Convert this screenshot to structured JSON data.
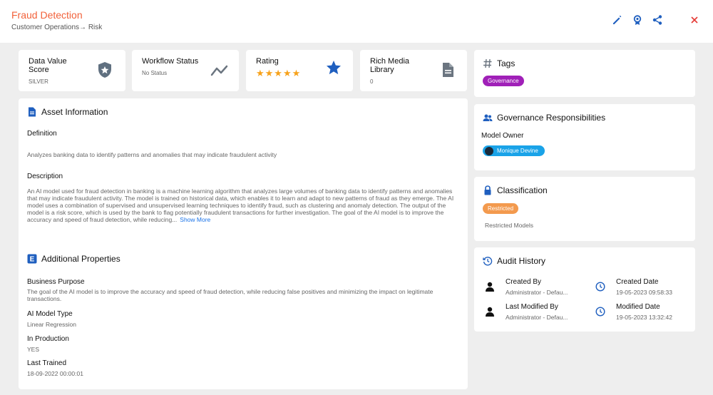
{
  "header": {
    "title": "Fraud Detection",
    "breadcrumb": "Customer Operations→ Risk"
  },
  "stats": {
    "data_value": {
      "label": "Data Value Score",
      "value": "SILVER"
    },
    "workflow": {
      "label": "Workflow Status",
      "value": "No Status"
    },
    "rating": {
      "label": "Rating",
      "stars": "★★★★★",
      "score": 5,
      "max": 5
    },
    "rich_media": {
      "label": "Rich Media Library",
      "value": "0"
    }
  },
  "asset_info": {
    "title": "Asset Information",
    "definition_label": "Definition",
    "definition": "Analyzes banking data to identify patterns and anomalies that may indicate fraudulent activity",
    "description_label": "Description",
    "description": "An AI model used for fraud detection in banking is a machine learning algorithm that analyzes large volumes of banking data to identify patterns and anomalies that may indicate fraudulent activity. The model is trained on historical data, which enables it to learn and adapt to new patterns of fraud as they emerge. The AI model uses a combination of supervised and unsupervised learning techniques to identify fraud, such as clustering and anomaly detection. The output of the model is a risk score, which is used by the bank to flag potentially fraudulent transactions for further investigation. The goal of the AI model is to improve the accuracy and speed of fraud detection, while reducing...",
    "show_more": "Show More"
  },
  "additional": {
    "title": "Additional Properties",
    "badge": "E",
    "business_purpose_label": "Business Purpose",
    "business_purpose": "The goal of the AI model is to improve the accuracy and speed of fraud detection, while reducing false positives and minimizing the impact on legitimate transactions.",
    "model_type_label": "AI Model Type",
    "model_type": "Linear Regression",
    "in_production_label": "In Production",
    "in_production": "YES",
    "last_trained_label": "Last Trained",
    "last_trained": "18-09-2022 00:00:01"
  },
  "tags": {
    "title": "Tags",
    "items": [
      "Governance"
    ]
  },
  "governance": {
    "title": "Governance Responsibilities",
    "owner_label": "Model Owner",
    "owner": "Monique Devine"
  },
  "classification": {
    "title": "Classification",
    "badge": "Restricted",
    "text": "Restricted Models"
  },
  "audit": {
    "title": "Audit History",
    "created_by_label": "Created By",
    "created_by": "Administrator - Defau...",
    "created_date_label": "Created Date",
    "created_date": "19-05-2023 09:58:33",
    "modified_by_label": "Last Modified By",
    "modified_by": "Administrator - Defau...",
    "modified_date_label": "Modified Date",
    "modified_date": "19-05-2023 13:32:42"
  },
  "colors": {
    "title": "#f2613a",
    "accent": "#1f5fbf",
    "tag": "#a020b8",
    "owner_pill": "#1aa3e8",
    "restricted": "#f39a4e",
    "star": "#f7a21b"
  }
}
